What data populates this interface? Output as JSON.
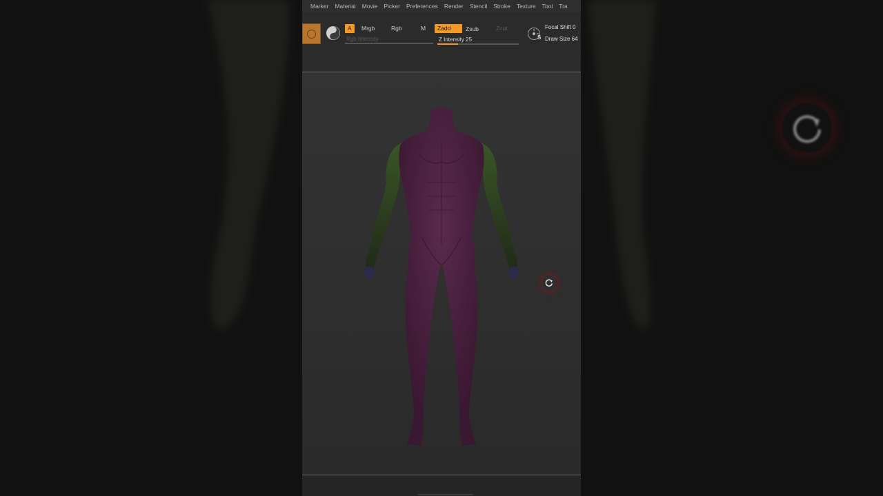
{
  "menu": {
    "items": [
      "Marker",
      "Material",
      "Movie",
      "Picker",
      "Preferences",
      "Render",
      "Stencil",
      "Stroke",
      "Texture",
      "Tool",
      "Tra"
    ]
  },
  "toolbar": {
    "a_label": "A",
    "mrgb_label": "Mrgb",
    "rgb_label": "Rgb",
    "m_label": "M",
    "zadd_label": "Zadd",
    "zsub_label": "Zsub",
    "zcut_label": "Zcut",
    "rgb_intensity_label": "Rgb Intensity",
    "z_intensity_label": "Z Intensity 25",
    "z_intensity_value": 25,
    "focal_shift_label": "Focal Shift 0",
    "draw_size_label": "Draw Size 64",
    "gizmo_letter": "S"
  },
  "icons": {
    "brush": "brush-circle-icon",
    "material": "yin-yang-icon",
    "gizmo": "gizmo-icon",
    "refresh": "refresh-icon"
  },
  "colors": {
    "accent": "#f29a25",
    "skin": "#4b2240",
    "arms": "#2c3a1e",
    "background": "#2b2b2b"
  }
}
